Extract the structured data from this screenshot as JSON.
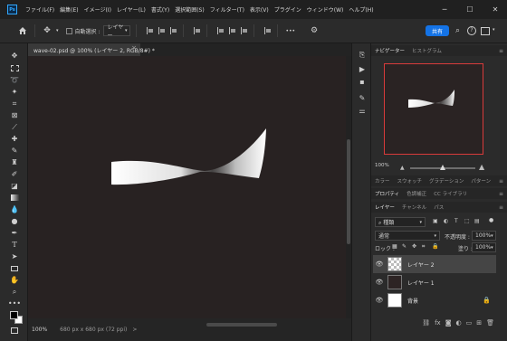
{
  "menu": [
    "ファイル(F)",
    "編集(E)",
    "イメージ(I)",
    "レイヤー(L)",
    "書式(Y)",
    "選択範囲(S)",
    "フィルター(T)",
    "表示(V)",
    "プラグイン",
    "ウィンドウ(W)",
    "ヘルプ(H)"
  ],
  "app": {
    "logo": "Ps"
  },
  "window_controls": {
    "minimize": "─",
    "restore": "☐",
    "close": "✕"
  },
  "options": {
    "auto_select_label": "自動選択 :",
    "auto_select_value": "レイヤー",
    "more": "•••",
    "share_label": "共有"
  },
  "document": {
    "tab_title": "wave-02.psd @ 100% (レイヤー 2, RGB/8#) *",
    "close": "×",
    "zoom": "100%",
    "dimensions": "680 px x 680 px (72 ppi)",
    "status_arrow": ">"
  },
  "navigator": {
    "tabs": [
      "ナビゲーター",
      "ヒストグラム"
    ],
    "zoom": "100%"
  },
  "color_tabs": [
    "カラー",
    "スウォッチ",
    "グラデーション",
    "パターン"
  ],
  "prop_tabs": [
    "プロパティ",
    "色調補正",
    "CC ライブラリ"
  ],
  "layers_tabs": [
    "レイヤー",
    "チャンネル",
    "パス"
  ],
  "layers": {
    "filter_kind": "種類",
    "blend_mode": "通常",
    "opacity_label": "不透明度 :",
    "opacity_value": "100%",
    "lock_label": "ロック :",
    "fill_label": "塗り :",
    "fill_value": "100%",
    "items": [
      {
        "name": "レイヤー 2",
        "selected": true
      },
      {
        "name": "レイヤー 1",
        "selected": false
      },
      {
        "name": "背景",
        "selected": false
      }
    ]
  },
  "colors": {
    "accent": "#1473e6",
    "nav_frame": "#d83b3b"
  }
}
